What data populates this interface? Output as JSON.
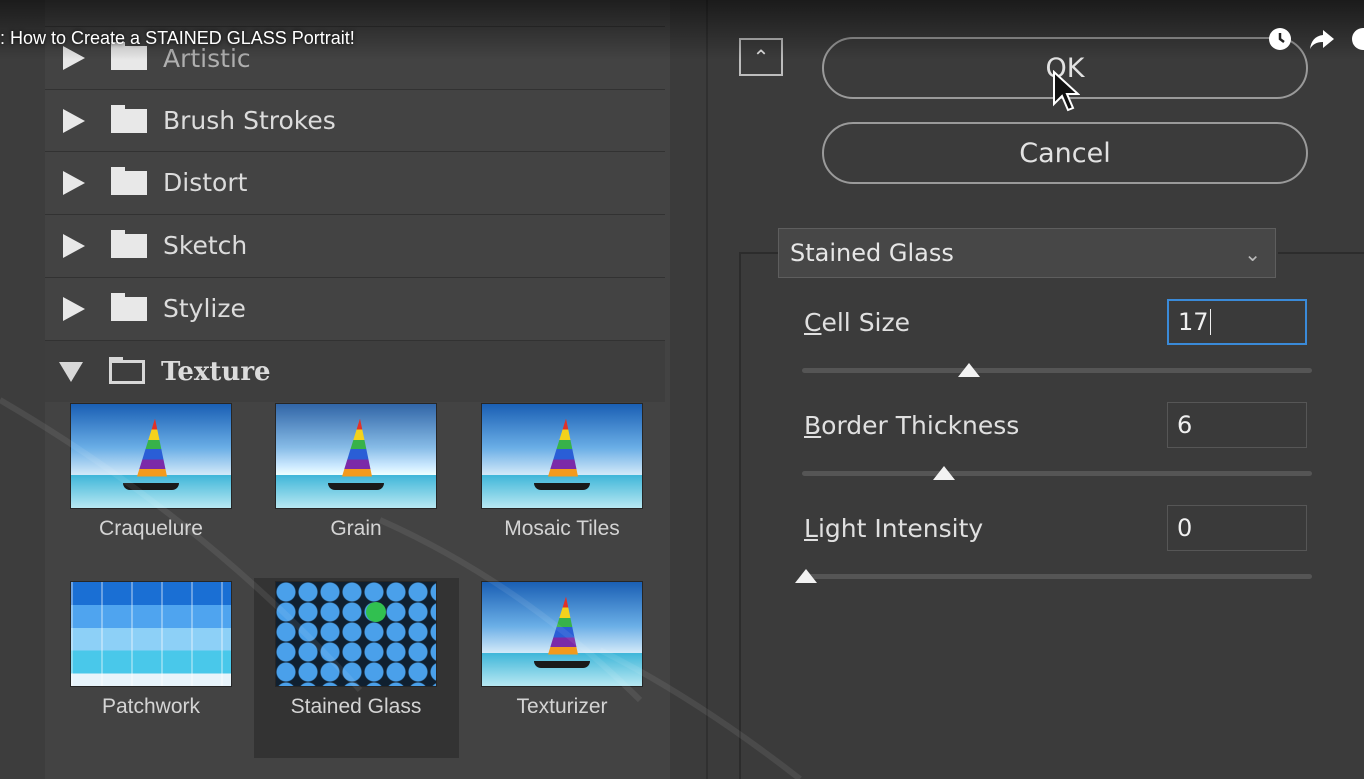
{
  "video": {
    "title": ": How to Create a STAINED GLASS Portrait!"
  },
  "filter_categories": [
    {
      "label": "Artistic",
      "expanded": false
    },
    {
      "label": "Brush Strokes",
      "expanded": false
    },
    {
      "label": "Distort",
      "expanded": false
    },
    {
      "label": "Sketch",
      "expanded": false
    },
    {
      "label": "Stylize",
      "expanded": false
    },
    {
      "label": "Texture",
      "expanded": true
    }
  ],
  "texture_filters": [
    {
      "label": "Craquelure",
      "selected": false
    },
    {
      "label": "Grain",
      "selected": false
    },
    {
      "label": "Mosaic Tiles",
      "selected": false
    },
    {
      "label": "Patchwork",
      "selected": false
    },
    {
      "label": "Stained Glass",
      "selected": true
    },
    {
      "label": "Texturizer",
      "selected": false
    }
  ],
  "buttons": {
    "ok": "OK",
    "cancel": "Cancel"
  },
  "filter_select": {
    "value": "Stained Glass"
  },
  "params": [
    {
      "label_first": "C",
      "label_rest": "ell Size",
      "value": "17",
      "slider_fraction": 0.32,
      "focused": true
    },
    {
      "label_first": "B",
      "label_rest": "order Thickness",
      "value": "6",
      "slider_fraction": 0.27,
      "focused": false
    },
    {
      "label_first": "L",
      "label_rest": "ight Intensity",
      "value": "0",
      "slider_fraction": 0.0,
      "focused": false
    }
  ],
  "colors": {
    "accent_focus": "#3a8ad8",
    "panel_bg": "#434343",
    "dialog_bg": "#3b3b3b"
  }
}
